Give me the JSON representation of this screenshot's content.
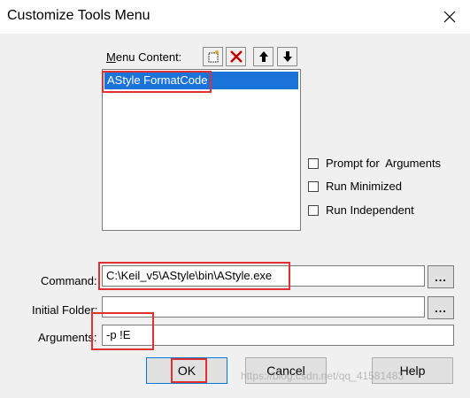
{
  "window": {
    "title": "Customize Tools Menu"
  },
  "menu_content": {
    "label_mnemonic": "M",
    "label_rest": "enu Content:",
    "items": [
      "AStyle FormatCode"
    ],
    "toolbar": [
      "new-item-icon",
      "delete-icon",
      "move-up-icon",
      "move-down-icon"
    ]
  },
  "options": {
    "prompt_for_arguments": "Prompt for  Arguments",
    "run_minimized": "Run Minimized",
    "run_independent": "Run Independent"
  },
  "fields": {
    "command_label": "Command:",
    "command_value": "C:\\Keil_v5\\AStyle\\bin\\AStyle.exe",
    "initial_folder_label": "Initial Folder:",
    "initial_folder_value": "",
    "arguments_label": "Arguments:",
    "arguments_value": "-p !E",
    "browse_label": "..."
  },
  "buttons": {
    "ok": "OK",
    "cancel": "Cancel",
    "help": "Help"
  },
  "watermark": "https://blog.csdn.net/qq_41581483",
  "colors": {
    "selection": "#1a73d9",
    "highlight": "#e03030",
    "delete_icon": "#c00000"
  }
}
